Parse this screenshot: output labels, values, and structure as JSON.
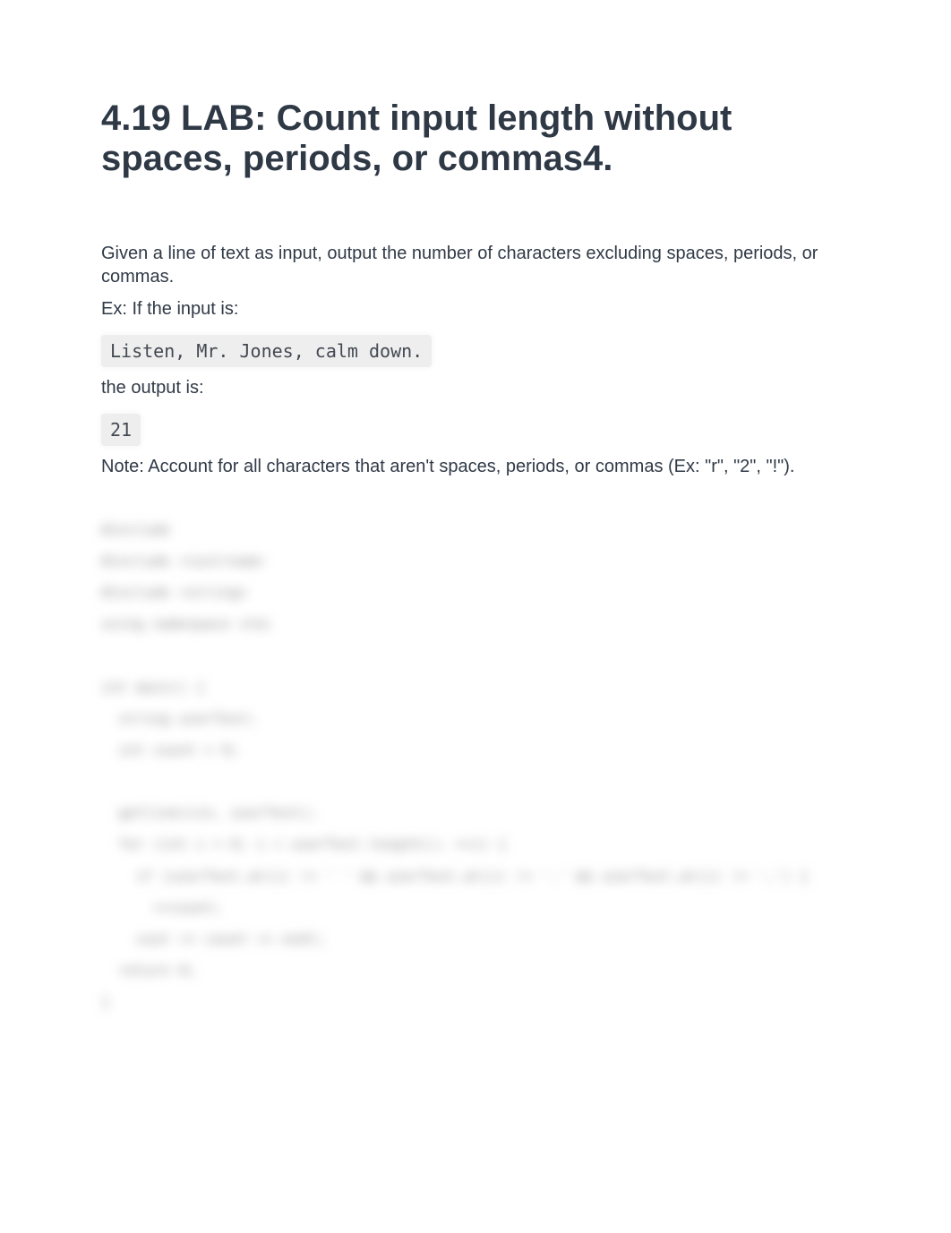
{
  "title": "4.19 LAB: Count input length without spaces, periods, or commas4.",
  "intro": "Given a line of text as input, output the number of characters excluding spaces, periods, or commas.",
  "example_label": "Ex: If the input is:",
  "example_input": "Listen, Mr. Jones, calm down.",
  "output_label": "the output is:",
  "example_output": "21",
  "note": "Note: Account for all characters that aren't spaces, periods, or commas (Ex: \"r\", \"2\", \"!\").",
  "blurred_code": "#include\n#include <iostream>\n#include <string>\nusing namespace std;\n\nint main() {\n  string userText;\n  int count = 0;\n\n  getline(cin, userText);\n  for (int i = 0; i < userText.length(); ++i) {\n    if (userText.at(i) != ' ' && userText.at(i) != '.' && userText.at(i) != ',') {\n      ++count;\n    cout << count << endl;\n  return 0;\n}"
}
